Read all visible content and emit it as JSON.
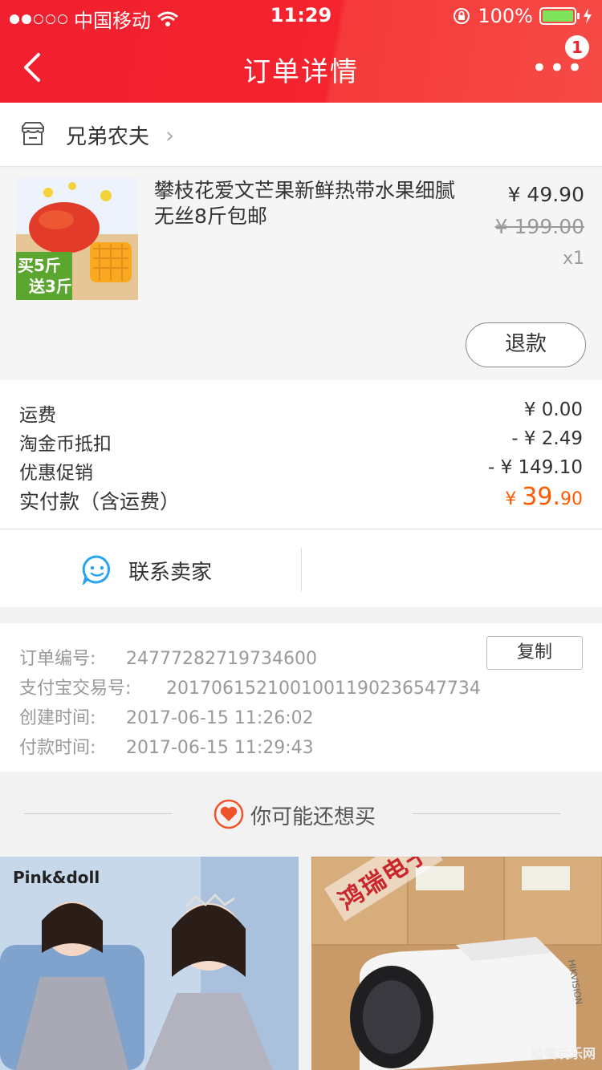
{
  "status_bar": {
    "carrier": "中国移动",
    "time": "11:29",
    "battery": "100%",
    "signal_bars_filled": 2,
    "signal_bars_total": 5
  },
  "navbar": {
    "title": "订单详情",
    "more_label": "•••",
    "notification_count": "1"
  },
  "shop": {
    "name": "兄弟农夫",
    "chevron": "›"
  },
  "product": {
    "image_badge_line1": "买5斤",
    "image_badge_line2": "送3斤",
    "name": "攀枝花爱文芒果新鲜热带水果细腻无丝8斤包邮",
    "price": "¥ 49.90",
    "original_price": "¥ 199.00",
    "quantity": "x1",
    "refund_label": "退款"
  },
  "fees": {
    "shipping_label": "运费",
    "shipping_value": "¥ 0.00",
    "coin_label": "淘金币抵扣",
    "coin_value": "- ¥ 2.49",
    "promo_label": "优惠促销",
    "promo_value": "- ¥ 149.10",
    "paid_label": "实付款（含运费）",
    "paid_currency": "¥ ",
    "paid_int": "39.",
    "paid_dec": "90"
  },
  "contact": {
    "label": "联系卖家"
  },
  "order_info": {
    "order_no_label": "订单编号:",
    "order_no": "24777282719734600",
    "alipay_label": "支付宝交易号:",
    "alipay_no": "2017061521001001190236547734",
    "created_label": "创建时间:",
    "created": "2017-06-15 11:26:02",
    "paid_label": "付款时间:",
    "paid": "2017-06-15 11:29:43",
    "copy_label": "复制"
  },
  "recommend": {
    "title": "你可能还想买",
    "card1_brand": "Pink&doll",
    "card2_watermark": "鸿瑞电子",
    "card2_product_text": "HIKVISION",
    "corner_watermark": "哈喝玩乐网"
  },
  "colors": {
    "header_red": "#f4232e",
    "accent_orange": "#ff5a00",
    "battery_green": "#7ee35a"
  }
}
